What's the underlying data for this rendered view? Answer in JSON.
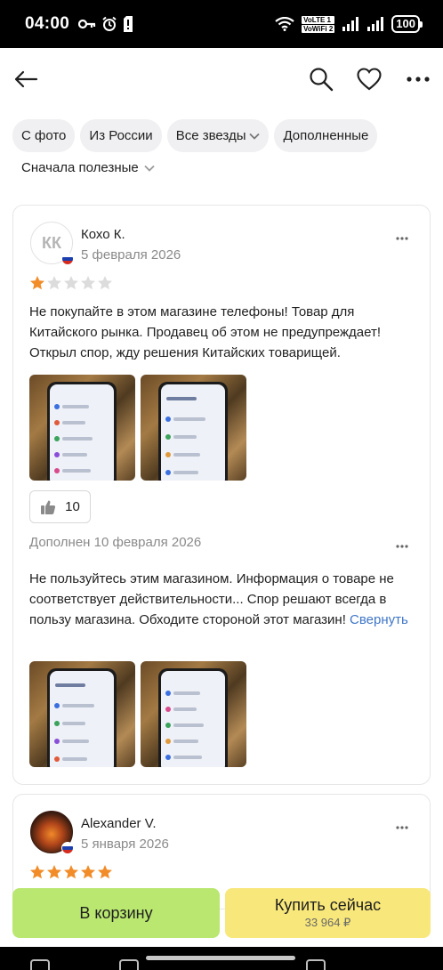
{
  "status_bar": {
    "time": "04:00",
    "network_top": "VoLTE 1",
    "network_bottom": "VoWiFi 2",
    "battery": "100"
  },
  "filters": [
    {
      "label": "С фото",
      "dropdown": false
    },
    {
      "label": "Из России",
      "dropdown": false
    },
    {
      "label": "Все звезды",
      "dropdown": true
    },
    {
      "label": "Дополненные",
      "dropdown": false
    }
  ],
  "sort_label": "Сначала полезные",
  "reviews": [
    {
      "author": "Кохо К.",
      "avatar_initials": "КК",
      "date": "5 февраля 2026",
      "rating": 1,
      "text": "Не покупайте в этом магазине телефоны! Товар для Китайского рынка. Продавец об этом не предупреждает! Открыл спор, жду решения Китайских товарищей.",
      "likes": "10",
      "addon_date": "Дополнен 10 февраля 2026",
      "addon_text": "Не пользуйтесь этим магазином. Информация о товаре не соответствует действительности... Спор решают всегда в пользу магазина. Обходите стороной этот магазин!",
      "collapse_link": "Свернуть"
    },
    {
      "author": "Alexander V.",
      "date": "5 января 2026",
      "rating": 5
    }
  ],
  "actions": {
    "cart_label": "В корзину",
    "buy_label": "Купить сейчас",
    "price": "33 964 ₽"
  },
  "colors": {
    "star_active": "#f28c28",
    "star_inactive": "#dcdcdc",
    "cart_button": "#b9e770",
    "buy_button": "#f8e77a",
    "link": "#3f76c7"
  }
}
